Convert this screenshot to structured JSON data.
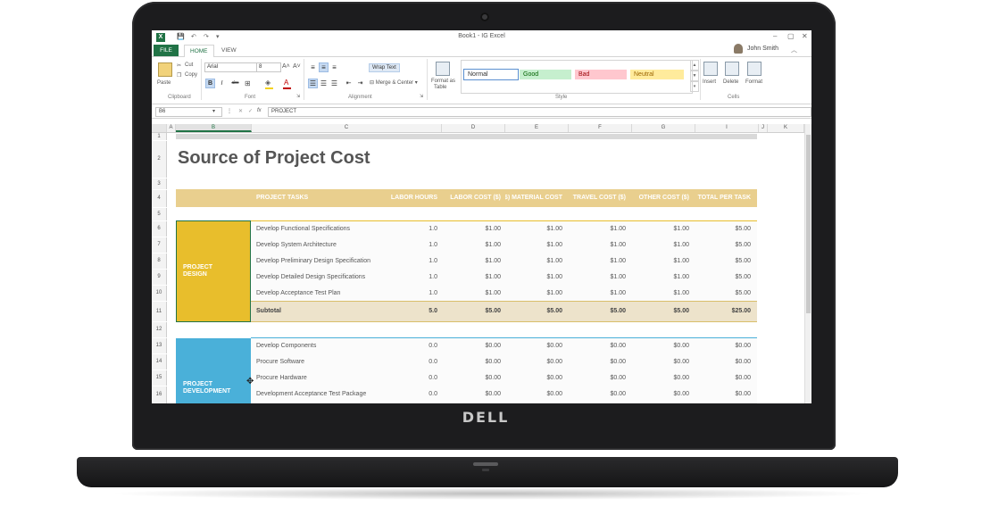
{
  "device": {
    "brand": "DELL"
  },
  "window": {
    "title": "Book1 - IG Excel",
    "user": "John Smith",
    "min": "–",
    "restore": "▢",
    "close": "✕",
    "qat": [
      "💾",
      "↶",
      "↷",
      "▾"
    ]
  },
  "tabs": [
    {
      "label": "FILE"
    },
    {
      "label": "HOME"
    },
    {
      "label": "VIEW"
    }
  ],
  "ribbon": {
    "clipboard": {
      "paste": "Paste",
      "cut": "Cut",
      "copy": "Copy",
      "label": "Clipboard"
    },
    "font": {
      "name": "Arial",
      "size": "8",
      "label": "Font",
      "bold": "B",
      "italic": "I",
      "strike": "abc"
    },
    "alignment": {
      "wrap": "Wrap Text",
      "merge": "Merge & Center",
      "label": "Alignment"
    },
    "format_table": {
      "line1": "Format as",
      "line2": "Table"
    },
    "styles": {
      "normal": "Normal",
      "good": "Good",
      "bad": "Bad",
      "neutral": "Neutral",
      "label": "Style"
    },
    "cells": {
      "insert": "Insert",
      "delete": "Delete",
      "format": "Format",
      "label": "Cells"
    }
  },
  "formula_bar": {
    "name_box": "B6",
    "value": "PROJECT"
  },
  "columns": [
    "A",
    "B",
    "C",
    "D",
    "E",
    "F",
    "G",
    "H",
    "I",
    "J",
    "K"
  ],
  "rows": [
    "1",
    "2",
    "3",
    "4",
    "5",
    "6",
    "7",
    "8",
    "9",
    "10",
    "11",
    "12",
    "13",
    "14",
    "15",
    "16"
  ],
  "sheet": {
    "title": "Source of Project Cost",
    "headers": [
      "PROJECT TASKS",
      "LABOR HOURS",
      "LABOR COST ($)",
      "MATERIAL COST ($)",
      "TRAVEL COST ($)",
      "OTHER COST ($)",
      "TOTAL PER TASK"
    ],
    "design": {
      "label_line1": "PROJECT",
      "label_line2": "DESIGN",
      "rows": [
        [
          "Develop Functional Specifications",
          "1.0",
          "$1.00",
          "$1.00",
          "$1.00",
          "$1.00",
          "$5.00"
        ],
        [
          "Develop System Architecture",
          "1.0",
          "$1.00",
          "$1.00",
          "$1.00",
          "$1.00",
          "$5.00"
        ],
        [
          "Develop Preliminary Design Specification",
          "1.0",
          "$1.00",
          "$1.00",
          "$1.00",
          "$1.00",
          "$5.00"
        ],
        [
          "Develop Detailed Design Specifications",
          "1.0",
          "$1.00",
          "$1.00",
          "$1.00",
          "$1.00",
          "$5.00"
        ],
        [
          "Develop Acceptance Test Plan",
          "1.0",
          "$1.00",
          "$1.00",
          "$1.00",
          "$1.00",
          "$5.00"
        ]
      ],
      "subtotal": [
        "Subtotal",
        "5.0",
        "$5.00",
        "$5.00",
        "$5.00",
        "$5.00",
        "$25.00"
      ]
    },
    "development": {
      "label_line1": "PROJECT",
      "label_line2": "DEVELOPMENT",
      "rows": [
        [
          "Develop Components",
          "0.0",
          "$0.00",
          "$0.00",
          "$0.00",
          "$0.00",
          "$0.00"
        ],
        [
          "Procure Software",
          "0.0",
          "$0.00",
          "$0.00",
          "$0.00",
          "$0.00",
          "$0.00"
        ],
        [
          "Procure Hardware",
          "0.0",
          "$0.00",
          "$0.00",
          "$0.00",
          "$0.00",
          "$0.00"
        ],
        [
          "Development Acceptance Test Package",
          "0.0",
          "$0.00",
          "$0.00",
          "$0.00",
          "$0.00",
          "$0.00"
        ]
      ]
    }
  },
  "colors": {
    "excel_green": "#217346",
    "design_yellow": "#e8be2c",
    "dev_blue": "#4ab0d9",
    "header_gold": "#e9cf8e"
  }
}
